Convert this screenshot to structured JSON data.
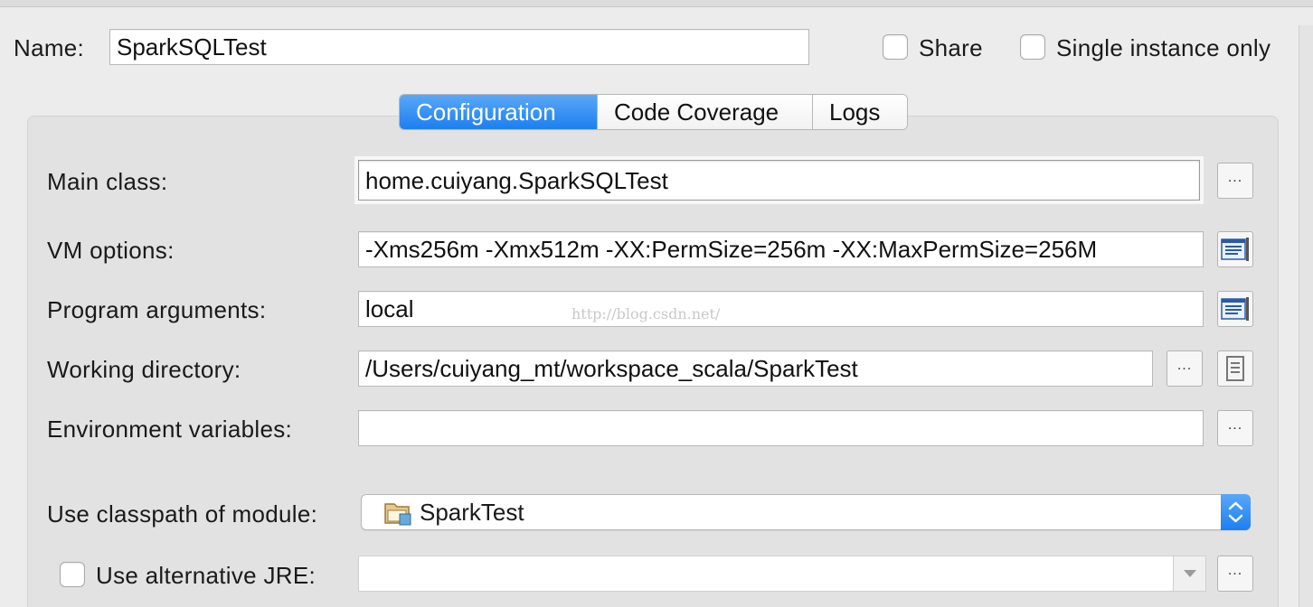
{
  "header": {
    "name_label": "Name:",
    "name_value": "SparkSQLTest",
    "share_label": "Share",
    "share_checked": false,
    "single_instance_label": "Single instance only",
    "single_instance_checked": false
  },
  "tabs": [
    {
      "label": "Configuration",
      "active": true
    },
    {
      "label": "Code Coverage",
      "active": false
    },
    {
      "label": "Logs",
      "active": false
    }
  ],
  "form": {
    "main_class_label": "Main class:",
    "main_class_value": "home.cuiyang.SparkSQLTest",
    "vm_options_label": "VM options:",
    "vm_options_value": "-Xms256m -Xmx512m -XX:PermSize=256m -XX:MaxPermSize=256M",
    "program_args_label": "Program arguments:",
    "program_args_value": "local",
    "working_dir_label": "Working directory:",
    "working_dir_value": "/Users/cuiyang_mt/workspace_scala/SparkTest",
    "env_vars_label": "Environment variables:",
    "env_vars_value": "",
    "classpath_label": "Use classpath of module:",
    "classpath_value": "SparkTest",
    "alt_jre_label": "Use alternative JRE:",
    "alt_jre_checked": false,
    "alt_jre_value": ""
  },
  "browse_button_label": "...",
  "watermark": "http://blog.csdn.net/",
  "colors": {
    "accent": "#1c7ff0",
    "background": "#ececec",
    "panel": "#e2e2e2"
  },
  "icons": {
    "expand_editor": "expand-editor-icon",
    "folder_module": "module-folder-icon",
    "macro": "insert-macro-icon",
    "dropdown": "chevron-down-icon",
    "stepper": "up-down-stepper-icon"
  }
}
